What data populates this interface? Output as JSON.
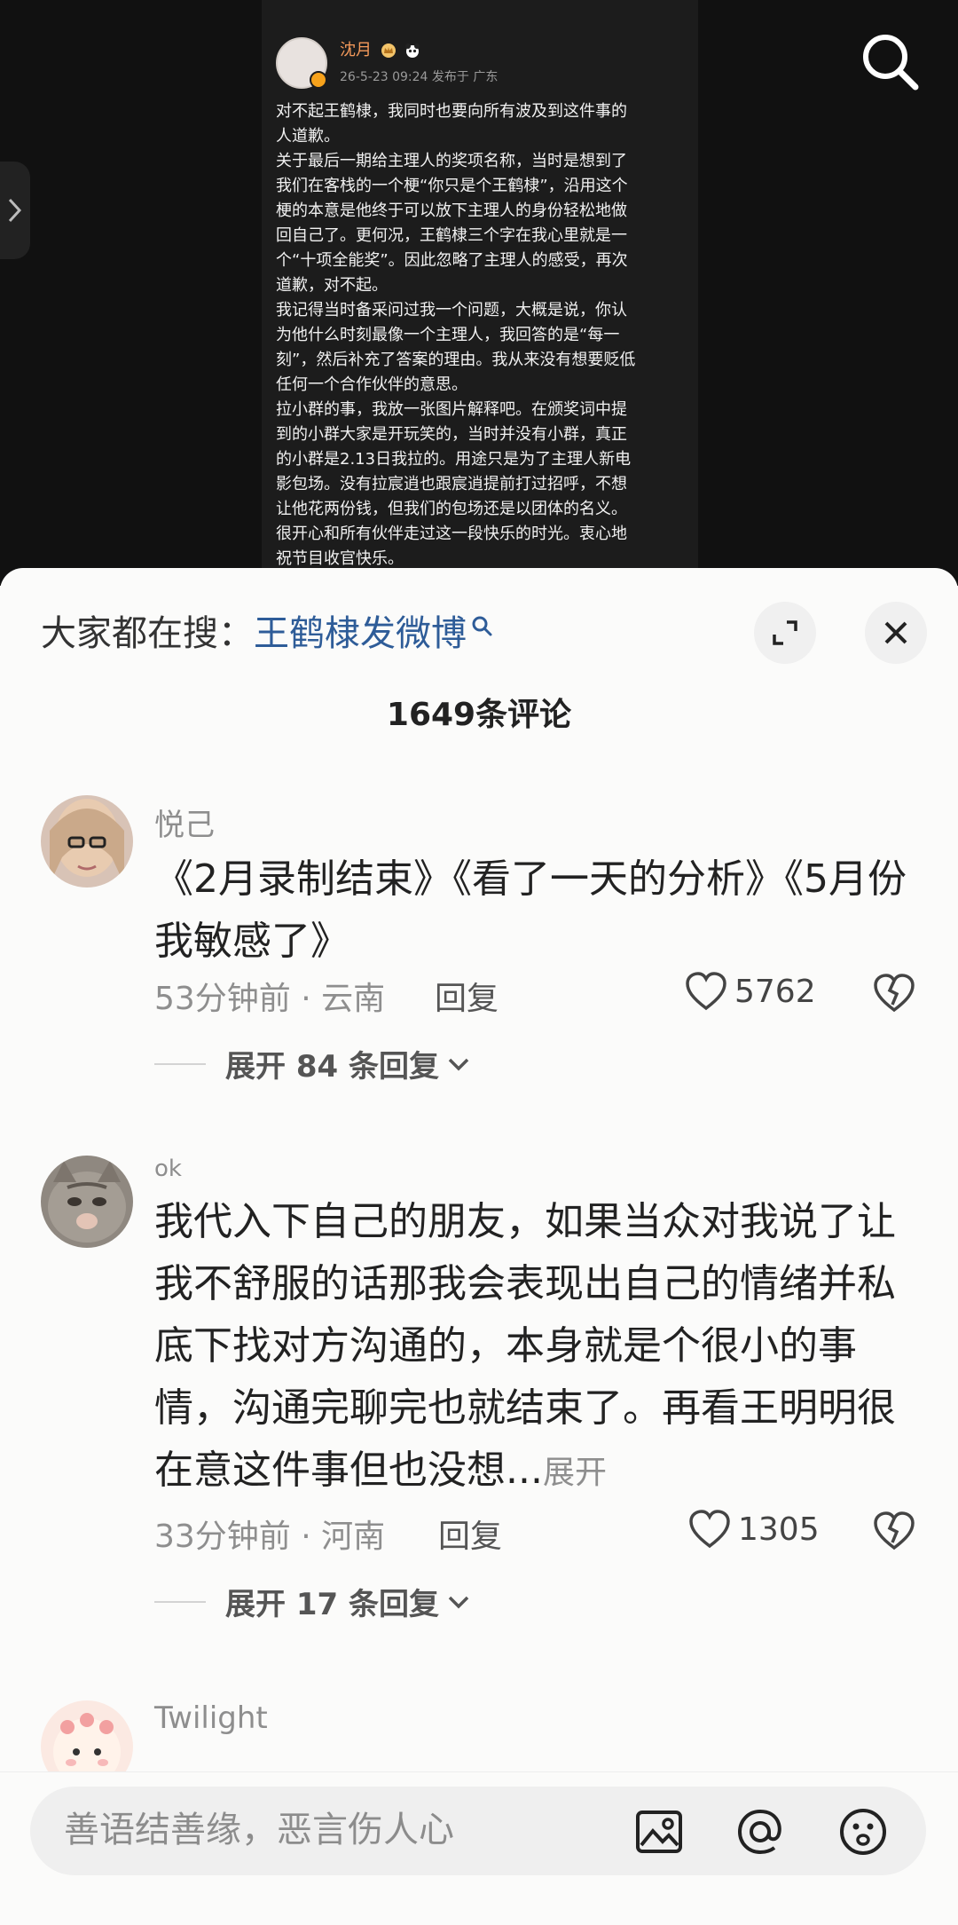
{
  "post": {
    "author": "沈月",
    "time_location": "26-5-23 09:24 发布于 广东",
    "body": "对不起王鹤棣，我同时也要向所有波及到这件事的\n人道歉。\n关于最后一期给主理人的奖项名称，当时是想到了\n我们在客栈的一个梗“你只是个王鹤棣”，沿用这个\n梗的本意是他终于可以放下主理人的身份轻松地做\n回自己了。更何况，王鹤棣三个字在我心里就是一\n个“十项全能奖”。因此忽略了主理人的感受，再次\n道歉，对不起。\n我记得当时备采问过我一个问题，大概是说，你认\n为他什么时刻最像一个主理人，我回答的是“每一\n刻”，然后补充了答案的理由。我从来没有想要贬低\n任何一个合作伙伴的意思。\n拉小群的事，我放一张图片解释吧。在颁奖词中提\n到的小群大家是开玩笑的，当时并没有小群，真正\n的小群是2.13日我拉的。用途只是为了主理人新电\n影包场。没有拉宸逍也跟宸逍提前打过招呼，不想\n让他花两份钱，但我们的包场还是以团体的名义。\n很开心和所有伙伴走过这一段快乐的时光。衷心地\n祝节目收官快乐。"
  },
  "sheet": {
    "hot_label": "大家都在搜：",
    "hot_link": "王鹤棣发微博",
    "comment_count": "1649条评论"
  },
  "comments": [
    {
      "name": "悦己",
      "text": "《2月录制结束》《看了一天的分析》《5月份我敏感了》",
      "time_location": "53分钟前 · 云南",
      "reply_label": "回复",
      "likes": "5762",
      "expand": "展开 84 条回复"
    },
    {
      "name": "ok",
      "text": "我代入下自己的朋友，如果当众对我说了让我不舒服的话那我会表现出自己的情绪并私底下找对方沟通的，本身就是个很小的事情，沟通完聊完也就结束了。再看王明明很在意这件事但也没想...",
      "more": "展开",
      "time_location": "33分钟前 · 河南",
      "reply_label": "回复",
      "likes": "1305",
      "expand": "展开 17 条回复"
    },
    {
      "name": "Twilight"
    }
  ],
  "input": {
    "placeholder": "善语结善缘，恶言伤人心"
  },
  "icons": [
    "search-icon",
    "chevron-right-icon",
    "expand-icon",
    "close-icon",
    "heart-icon",
    "heartbreak-icon",
    "chevron-down-icon",
    "image-icon",
    "at-icon",
    "emoji-icon"
  ]
}
